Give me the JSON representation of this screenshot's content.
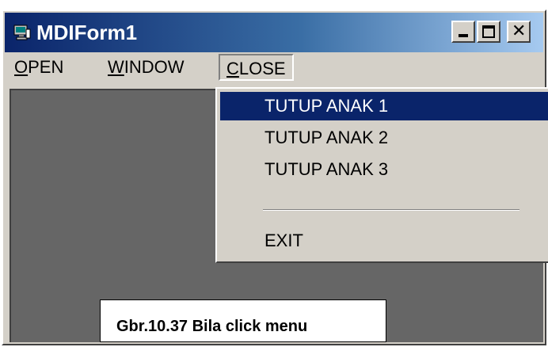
{
  "window": {
    "title": "MDIForm1"
  },
  "controls": {
    "close_glyph": "✕"
  },
  "menubar": {
    "open": {
      "accel": "O",
      "rest": "PEN"
    },
    "window": {
      "accel": "W",
      "rest": "INDOW"
    },
    "close": {
      "accel": "C",
      "rest": "LOSE"
    }
  },
  "close_menu": {
    "items": [
      "TUTUP ANAK 1",
      "TUTUP ANAK 2",
      "TUTUP ANAK 3"
    ],
    "exit": "EXIT",
    "selected_index": 0
  },
  "caption": "Gbr.10.37 Bila click menu",
  "colors": {
    "title_active": "#0a246a",
    "highlight": "#0a246a",
    "mdi_background": "#666666",
    "face": "#d4d0c8"
  }
}
